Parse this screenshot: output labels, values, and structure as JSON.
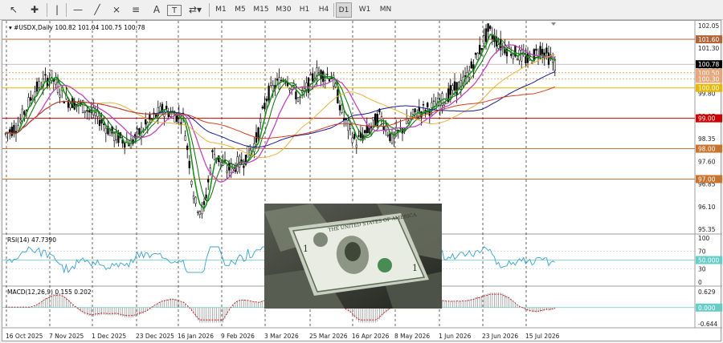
{
  "toolbar": {
    "timeframes": [
      "M1",
      "M5",
      "M15",
      "M30",
      "H1",
      "H4",
      "D1",
      "W1",
      "MN"
    ],
    "active_timeframe": "D1",
    "tool_icons": [
      "cursor-icon",
      "crosshair-icon",
      "vertical-line-icon",
      "horizontal-line-icon",
      "trendline-icon",
      "channel-icon",
      "fibonacci-icon",
      "text-icon",
      "arrows-dropdown-icon"
    ]
  },
  "chart": {
    "header": "#USDX,Daily  100.82 101.04 100.75 100.78",
    "price_labels": [
      "102.05",
      "101.30",
      "100.55",
      "99.80",
      "99.05",
      "98.35",
      "97.60",
      "96.85",
      "96.10",
      "95.35"
    ],
    "level_tags": [
      {
        "text": "101.60",
        "color": "#b4643a"
      },
      {
        "text": "100.78",
        "color": "#000000"
      },
      {
        "text": "100.50",
        "color": "#e8a77a"
      },
      {
        "text": "100.30",
        "color": "#e8a77a"
      },
      {
        "text": "100.00",
        "color": "#e6b800"
      },
      {
        "text": "99.00",
        "color": "#cc0000"
      },
      {
        "text": "98.00",
        "color": "#c8742e"
      },
      {
        "text": "97.00",
        "color": "#c8742e"
      }
    ],
    "date_labels": [
      "16 Oct 2025",
      "7 Nov 2025",
      "1 Dec 2025",
      "23 Dec 2025",
      "16 Jan 2026",
      "9 Feb 2026",
      "3 Mar 2026",
      "25 Mar 2026",
      "16 Apr 2026",
      "8 May 2026",
      "1 Jun 2026",
      "23 Jun 2026",
      "15 Jul 2026"
    ]
  },
  "rsi": {
    "header": "RSI(14) 47.7390",
    "scale": [
      "100",
      "70",
      "50",
      "30",
      "0"
    ],
    "value_tag": "50.000"
  },
  "macd": {
    "header": "MACD(12,26,9) 0.155 0.202",
    "scale": [
      "0.629",
      "0.000",
      "-0.644"
    ],
    "value_tag": "0.000"
  },
  "colors": {
    "candles": "#000000",
    "ma_fast": "#1a8f1a",
    "ma_mid": "#c044c0",
    "ma_slow1": "#e8b23a",
    "ma_slow2": "#1a1a8f",
    "ma_slow3": "#d04020",
    "rsi_line": "#3aa0d0",
    "macd_signal": "#cc0000"
  }
}
